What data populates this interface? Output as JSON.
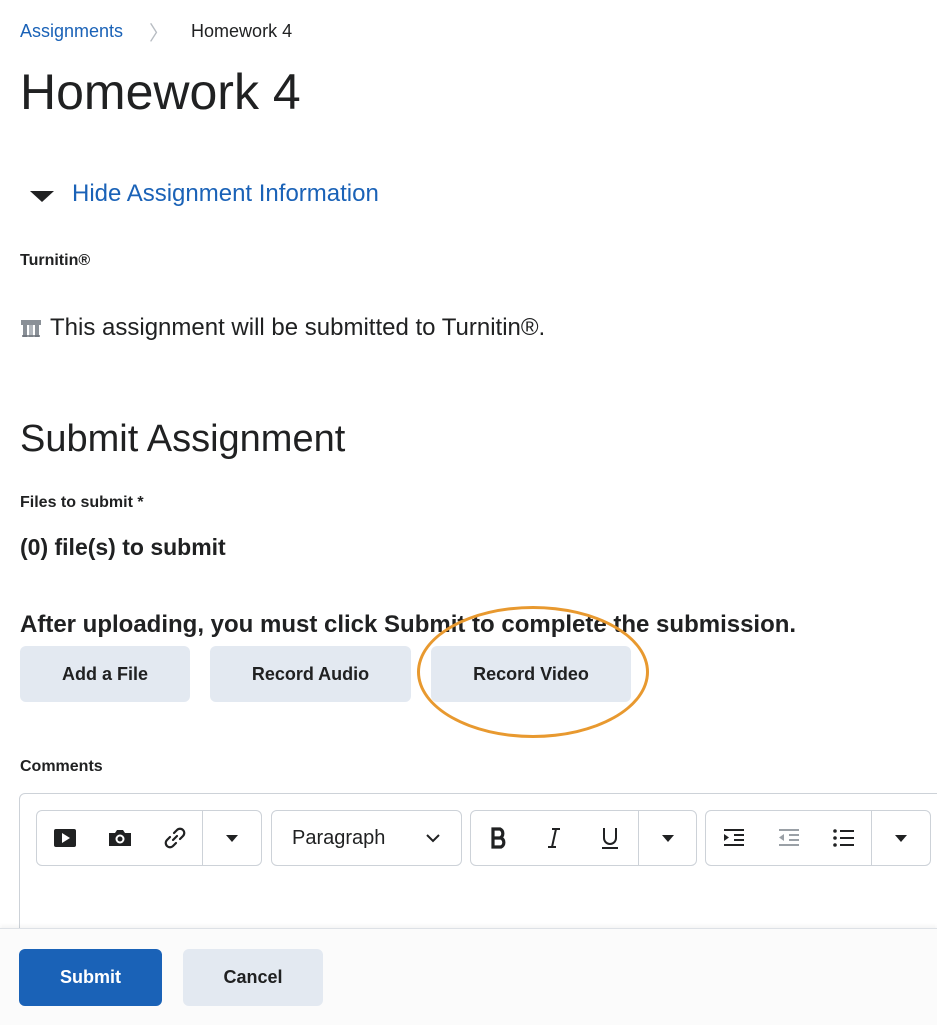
{
  "breadcrumb": {
    "parent": "Assignments",
    "separator": "〉",
    "current": "Homework 4"
  },
  "page_title": "Homework 4",
  "info_toggle": {
    "label": "Hide Assignment Information",
    "icon": "caret-down-icon"
  },
  "turnitin": {
    "heading": "Turnitin®",
    "message": "This assignment will be submitted to Turnitin®.",
    "icon": "turnitin-icon"
  },
  "submit_section": {
    "title": "Submit Assignment",
    "files_label": "Files to submit",
    "required_marker": "*",
    "files_count": "(0) file(s) to submit",
    "instruction": "After uploading, you must click Submit to complete the submission.",
    "buttons": {
      "add_file": "Add a File",
      "record_audio": "Record Audio",
      "record_video": "Record Video"
    }
  },
  "comments": {
    "label": "Comments",
    "toolbar": {
      "insert_icons": [
        "video-icon",
        "camera-icon",
        "link-icon",
        "more-insert-chevron-icon"
      ],
      "format_select": "Paragraph",
      "text_format_icons": [
        "bold-icon",
        "italic-icon",
        "underline-icon",
        "more-format-chevron-icon"
      ],
      "list_icons": [
        "indent-icon",
        "outdent-icon",
        "bullet-list-icon",
        "more-list-chevron-icon"
      ]
    }
  },
  "footer": {
    "submit_label": "Submit",
    "cancel_label": "Cancel"
  },
  "colors": {
    "link": "#1a62b7",
    "primary_button": "#1a62b7",
    "secondary_button": "#e3e9f1",
    "annotation": "#e8992f"
  }
}
